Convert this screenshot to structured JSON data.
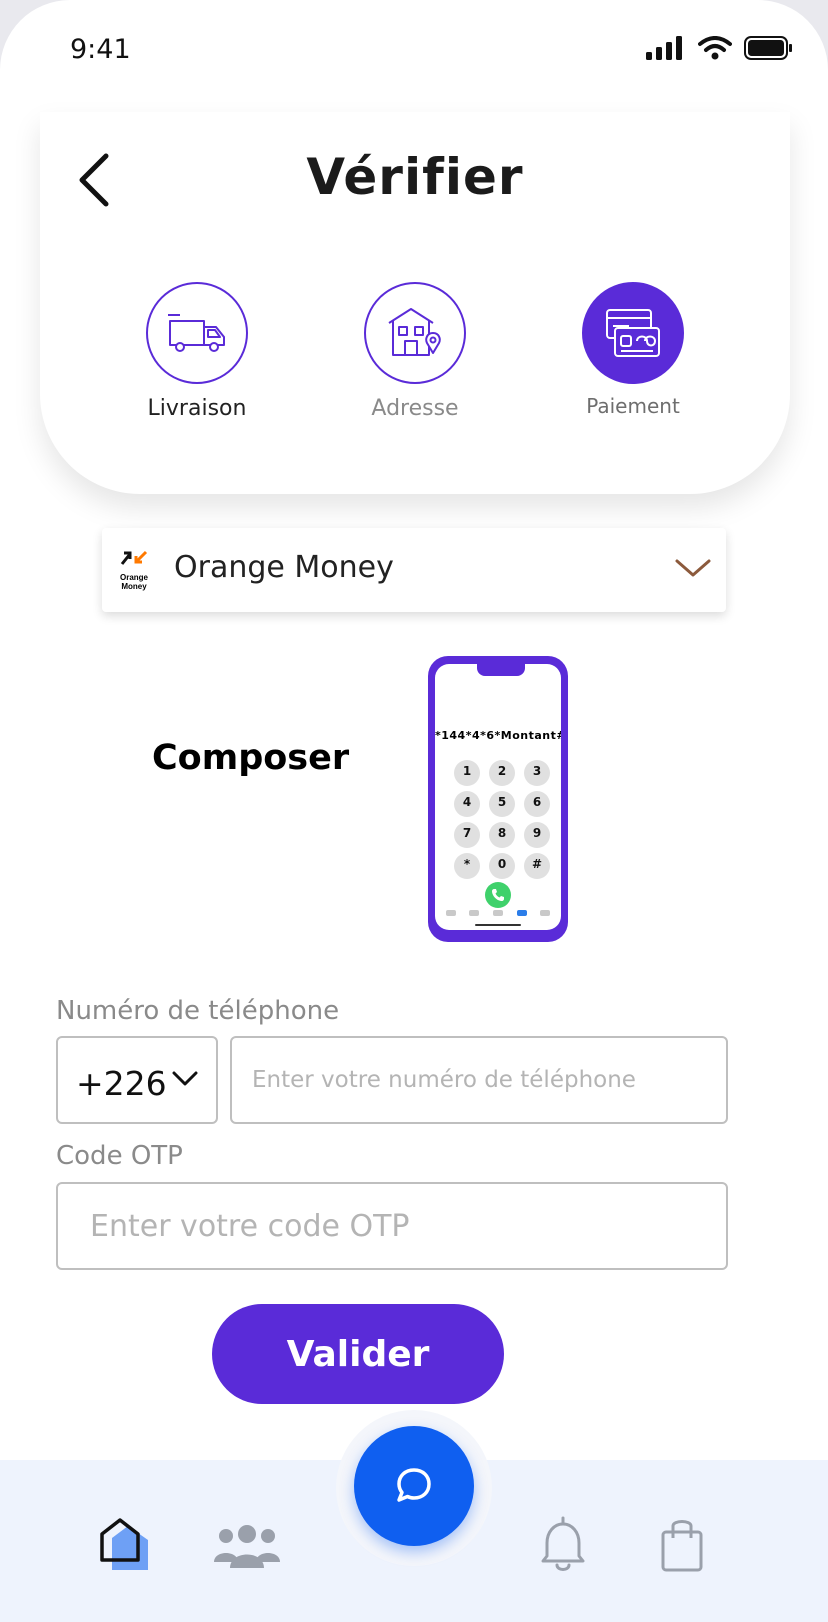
{
  "status_bar": {
    "time": "9:41"
  },
  "header": {
    "title": "Vérifier"
  },
  "steps": [
    {
      "label": "Livraison",
      "icon": "delivery-truck-icon"
    },
    {
      "label": "Adresse",
      "icon": "house-location-icon"
    },
    {
      "label": "Paiement",
      "icon": "credit-card-icon",
      "active": true
    }
  ],
  "payment_method": {
    "selected": "Orange Money",
    "logo_text": "Orange Money"
  },
  "dial_instruction": {
    "label": "Composer",
    "code": "*144*4*6*Montant#",
    "keypad_keys": [
      "1",
      "2",
      "3",
      "4",
      "5",
      "6",
      "7",
      "8",
      "9",
      "*",
      "0",
      "#"
    ]
  },
  "form": {
    "phone_label": "Numéro de téléphone",
    "country_code": "+226",
    "phone_placeholder": "Enter votre numéro de téléphone",
    "otp_label": "Code OTP",
    "otp_placeholder": "Enter votre code OTP",
    "submit_label": "Valider"
  },
  "colors": {
    "primary": "#5a2bd8",
    "fab": "#0f5ff0",
    "nav_background": "#eef3fd",
    "orange_money": "#ff7900"
  }
}
